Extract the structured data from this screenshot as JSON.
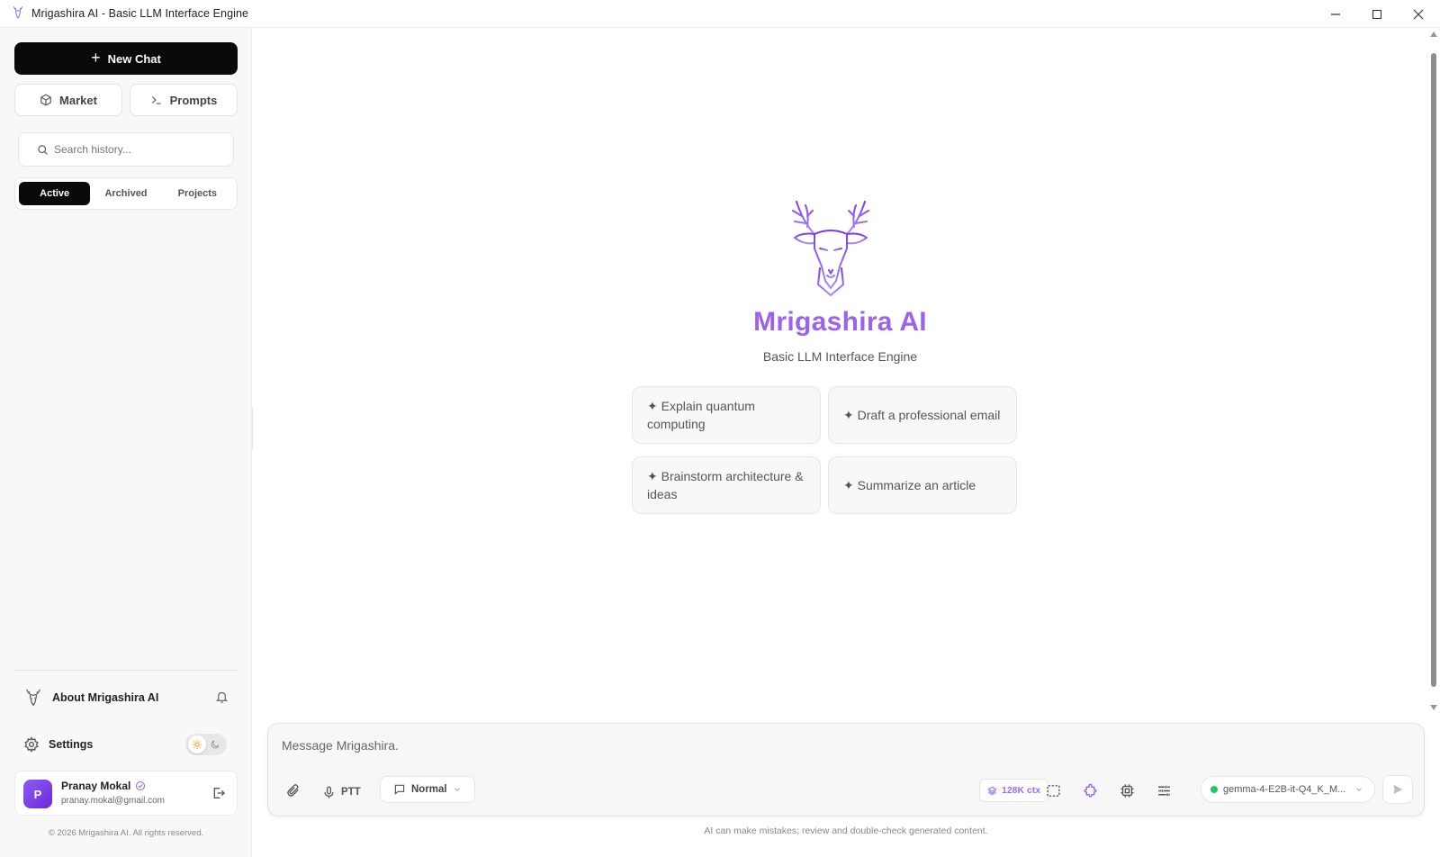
{
  "window": {
    "title": "Mrigashira AI - Basic LLM Interface Engine",
    "minimize_label": "",
    "maximize_label": "",
    "close_label": ""
  },
  "sidebar": {
    "new_chat_label": "New Chat",
    "market_label": "Market",
    "prompts_label": "Prompts",
    "search_placeholder": "Search history...",
    "tabs": [
      {
        "label": "Active",
        "active": true
      },
      {
        "label": "Archived",
        "active": false
      },
      {
        "label": "Projects",
        "active": false
      }
    ],
    "about_label": "About Mrigashira AI",
    "settings_label": "Settings",
    "user": {
      "initial": "P",
      "name": "Pranay Mokal",
      "email": "pranay.mokal@gmail.com"
    },
    "copyright": "© 2026 Mrigashira AI. All rights reserved."
  },
  "main": {
    "brand": "Mrigashira AI",
    "subtitle": "Basic LLM Interface Engine",
    "suggestions": [
      "✦ Explain quantum computing",
      "✦ Draft a professional email",
      "✦ Brainstorm architecture & ideas",
      "✦ Summarize an article"
    ]
  },
  "composer": {
    "placeholder": "Message Mrigashira.",
    "ptt_label": "PTT",
    "mode_label": "Normal",
    "context_label": "128K ctx",
    "model_name": "gemma-4-E2B-it-Q4_K_M...",
    "model_status_color": "#22c55e"
  },
  "disclaimer": "AI can make mistakes; review and double-check generated content.",
  "colors": {
    "accent": "#9b62f0",
    "primary_button": "#0a0a0a"
  },
  "icons": {
    "app": "deer-logo-icon",
    "market": "cube-icon",
    "prompts": "terminal-icon",
    "search": "search-icon",
    "bell": "bell-icon",
    "settings": "gear-icon",
    "theme_light": "sun-icon",
    "theme_dark": "moon-icon",
    "verified": "verified-badge-icon",
    "logout": "logout-icon",
    "attach": "paperclip-icon",
    "mic": "microphone-icon",
    "chat_mode": "message-square-icon",
    "context": "layers-icon",
    "screenshot": "dashed-square-icon",
    "plugins": "puzzle-icon",
    "cpu": "cpu-icon",
    "tune": "sliders-icon",
    "send": "send-icon"
  }
}
